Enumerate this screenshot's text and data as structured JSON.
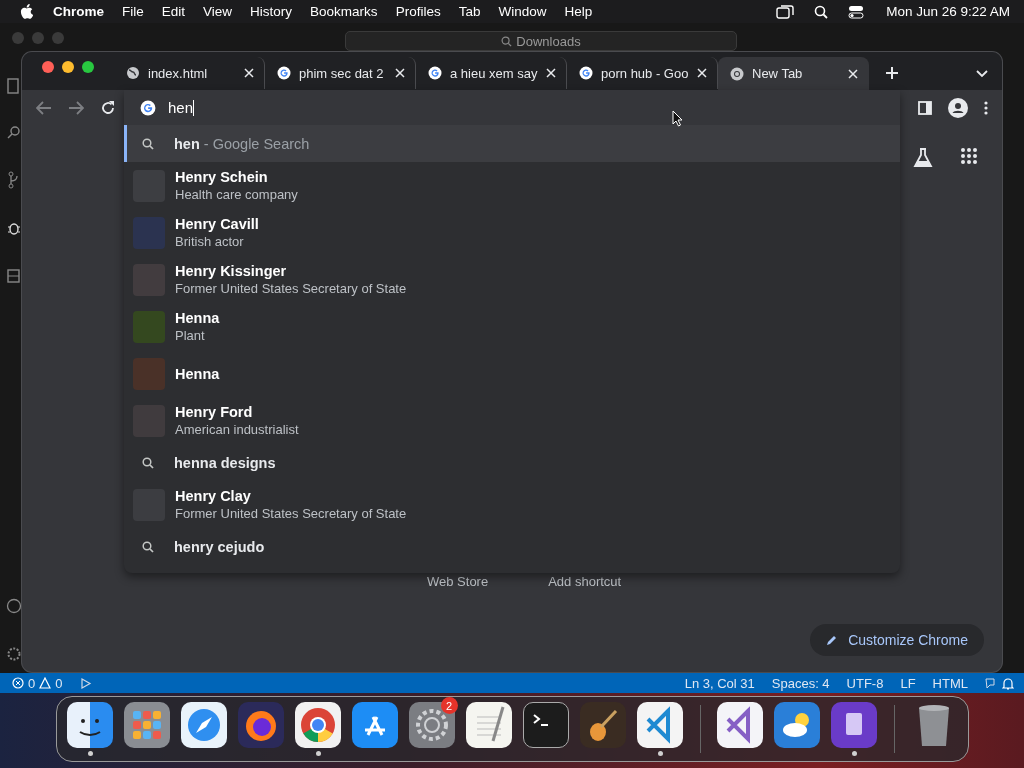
{
  "menu_bar": {
    "app": "Chrome",
    "menus": [
      "File",
      "Edit",
      "View",
      "History",
      "Bookmarks",
      "Profiles",
      "Tab",
      "Window",
      "Help"
    ],
    "clock": "Mon Jun 26  9:22 AM"
  },
  "editor_window": {
    "search": "Downloads"
  },
  "browser": {
    "tabs": [
      {
        "title": "index.html",
        "kind": "globe",
        "selected": false
      },
      {
        "title": "phim sec dat 2",
        "kind": "google",
        "selected": false
      },
      {
        "title": "a hieu xem say",
        "kind": "google",
        "selected": false
      },
      {
        "title": "porn hub - Goo",
        "kind": "google",
        "selected": false
      },
      {
        "title": "New Tab",
        "kind": "chrome",
        "selected": true
      }
    ],
    "omnibox": {
      "value": "hen"
    },
    "suggestions": [
      {
        "kind": "search",
        "title": "hen",
        "suffix": " - Google Search",
        "selected": true
      },
      {
        "kind": "entity",
        "title": "Henry Schein",
        "subtitle": "Health care company",
        "color": "#3d3e42",
        "selected": false
      },
      {
        "kind": "entity",
        "title": "Henry Cavill",
        "subtitle": "British actor",
        "color": "#2b3350",
        "selected": false
      },
      {
        "kind": "entity",
        "title": "Henry Kissinger",
        "subtitle": "Former United States Secretary of State",
        "color": "#423c3f",
        "selected": false
      },
      {
        "kind": "entity",
        "title": "Henna",
        "subtitle": "Plant",
        "color": "#34481f",
        "selected": false
      },
      {
        "kind": "entity",
        "title": "Henna",
        "color": "#4a3128",
        "selected": false
      },
      {
        "kind": "entity",
        "title": "Henry Ford",
        "subtitle": "American industrialist",
        "color": "#403b3e",
        "selected": false
      },
      {
        "kind": "search",
        "title": "henna designs",
        "selected": false
      },
      {
        "kind": "entity",
        "title": "Henry Clay",
        "subtitle": "Former United States Secretary of State",
        "color": "#3c3d41",
        "selected": false
      },
      {
        "kind": "search",
        "title": "henry cejudo",
        "selected": false
      }
    ],
    "shortcuts": [
      "Web Store",
      "Add shortcut"
    ],
    "customize_button": "Customize Chrome"
  },
  "status_bar": {
    "errors": "0",
    "warnings": "0",
    "items": [
      "Ln 3, Col 31",
      "Spaces: 4",
      "UTF-8",
      "LF",
      "HTML"
    ]
  },
  "dock": {
    "apps": [
      {
        "kind": "finder",
        "running": true
      },
      {
        "kind": "launchpad",
        "running": false
      },
      {
        "kind": "safari",
        "running": false
      },
      {
        "kind": "firefox",
        "running": false
      },
      {
        "kind": "chrome",
        "running": true
      },
      {
        "kind": "appstore",
        "running": false
      },
      {
        "kind": "settings",
        "running": false,
        "badge": "2"
      },
      {
        "kind": "textedit",
        "running": false
      },
      {
        "kind": "terminal",
        "running": false
      },
      {
        "kind": "garageband",
        "running": false
      },
      {
        "kind": "vscode",
        "running": true
      },
      {
        "kind": "separator"
      },
      {
        "kind": "visualstudio",
        "running": false
      },
      {
        "kind": "weather",
        "running": false
      },
      {
        "kind": "configurator",
        "running": true
      },
      {
        "kind": "separator"
      },
      {
        "kind": "trash",
        "running": false
      }
    ]
  }
}
